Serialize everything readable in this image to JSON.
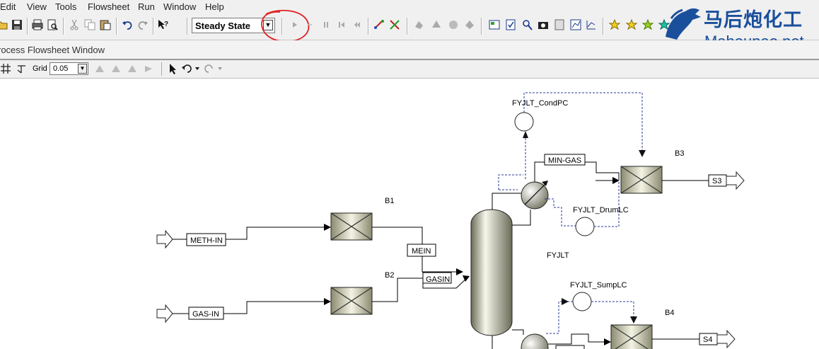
{
  "menu": [
    "Edit",
    "View",
    "Tools",
    "Flowsheet",
    "Run",
    "Window",
    "Help"
  ],
  "toolbar": {
    "run_mode": "Steady State"
  },
  "window": {
    "title": "rocess Flowsheet Window"
  },
  "grid": {
    "label": "Grid",
    "value": "0.05"
  },
  "flowsheet": {
    "streams": {
      "meth_in": "METH-IN",
      "gas_in": "GAS-IN",
      "mein": "MEIN",
      "gasin": "GASIN",
      "min_gas": "MIN-GAS",
      "s3": "S3",
      "s4": "S4"
    },
    "blocks": {
      "b1": "B1",
      "b2": "B2",
      "b3": "B3",
      "b4": "B4",
      "column": "FYJLT"
    },
    "controllers": {
      "cond_pc": "FYJLT_CondPC",
      "drum_lc": "FYJLT_DrumLC",
      "sump_lc": "FYJLT_SumpLC"
    }
  },
  "watermark": {
    "cn": "马后炮化工",
    "en": "Mahoupao.net"
  },
  "colors": {
    "accent_circle": "#e02020",
    "watermark": "#1a4f9c",
    "control_line": "#2a3a9a"
  }
}
